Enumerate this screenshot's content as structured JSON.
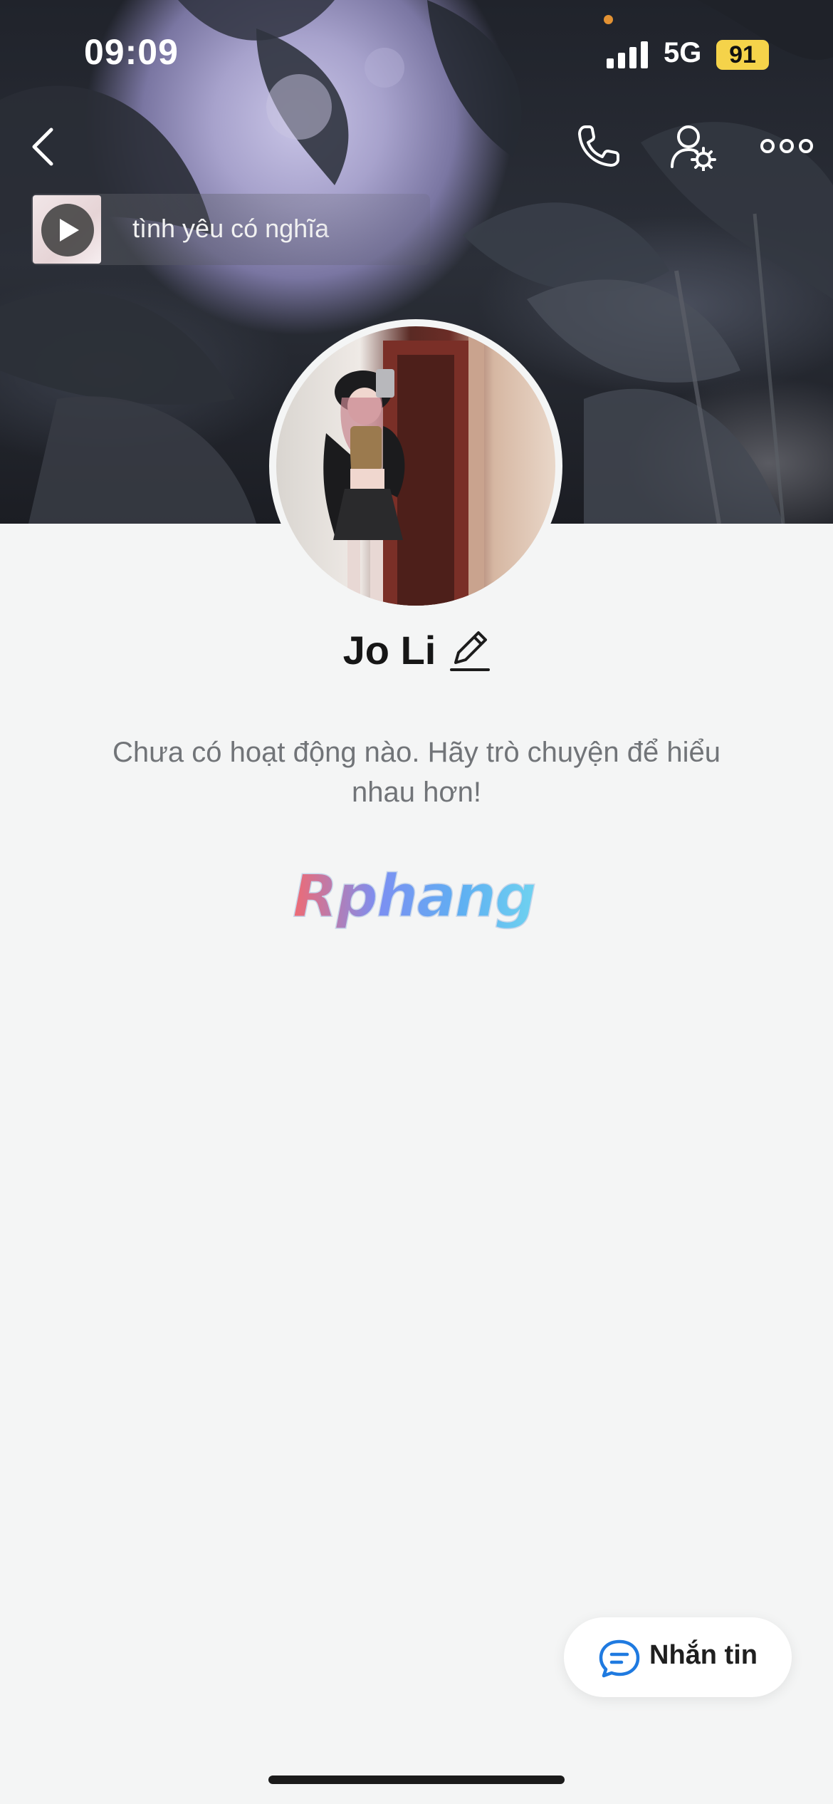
{
  "status_bar": {
    "time": "09:09",
    "network": "5G",
    "battery": "91",
    "battery_color": "#f5d34a"
  },
  "nav": {
    "back_icon": "chevron-left-icon",
    "call_icon": "phone-icon",
    "profile_settings_icon": "user-gear-icon",
    "more_icon": "more-icon"
  },
  "music": {
    "title": "tình yêu có nghĩa",
    "play_icon": "play-icon"
  },
  "profile": {
    "name": "Jo Li",
    "edit_icon": "pencil-icon",
    "empty_message": "Chưa có hoạt động nào. Hãy trò chuyện để hiểu nhau hơn!",
    "watermark": "Rphang"
  },
  "actions": {
    "message_label": "Nhắn tin",
    "message_icon": "chat-bubble-icon",
    "accent": "#1f7ae0"
  }
}
